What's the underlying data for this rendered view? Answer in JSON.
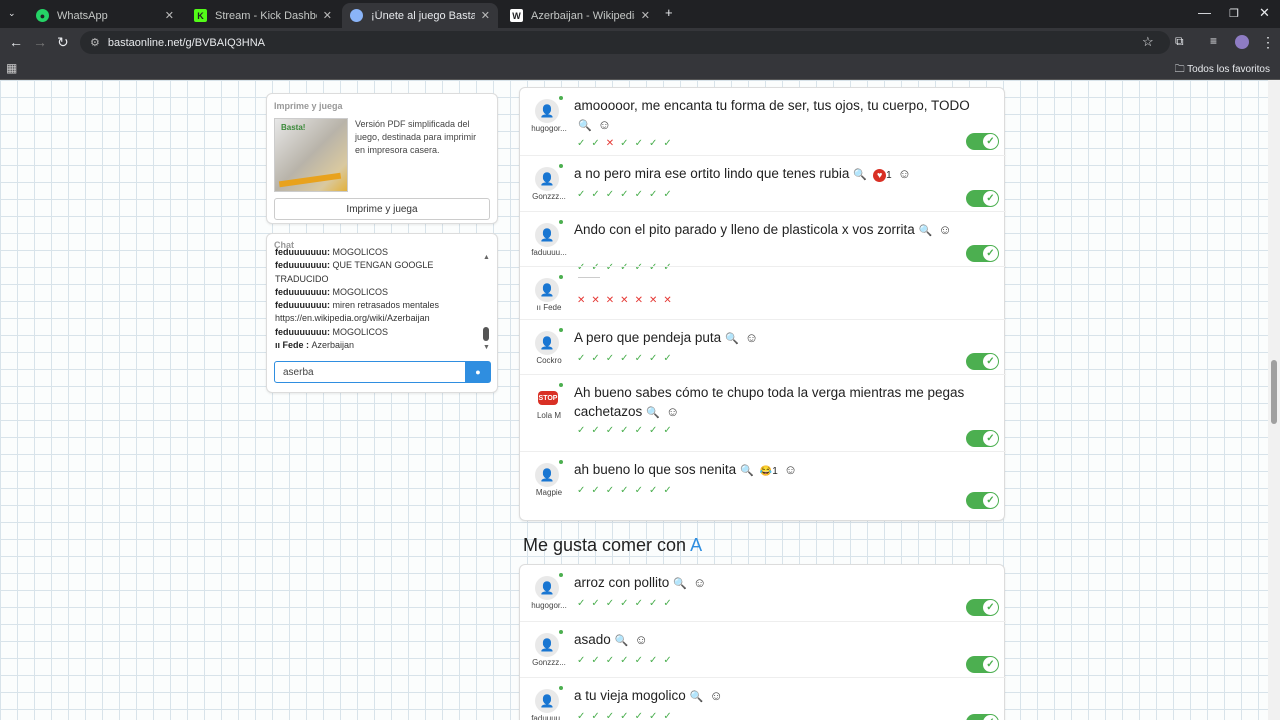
{
  "browser": {
    "tabs": [
      {
        "label": "WhatsApp",
        "icon": "whatsapp-icon",
        "color": "#25d366"
      },
      {
        "label": "Stream - Kick Dashboard",
        "icon": "kick-icon",
        "color": "#53fc18"
      },
      {
        "label": "¡Únete al juego Basta!",
        "icon": "globe-icon",
        "color": "#8ab4f8"
      },
      {
        "label": "Azerbaijan - Wikipedia",
        "icon": "wikipedia-icon",
        "color": "#ffffff"
      }
    ],
    "url": "bastaonline.net/g/BVBAIQ3HNA",
    "bookmarks_label": "Todos los favoritos"
  },
  "print_card": {
    "title": "Imprime y juega",
    "description": "Versión PDF simplificada del juego, destinada para imprimir en impresora casera.",
    "button": "Imprime y juega"
  },
  "chat": {
    "title": "Chat",
    "messages": [
      {
        "user": "feduuuuuuu:",
        "text": "MOGOLICOS"
      },
      {
        "user": "feduuuuuuu:",
        "text": "QUE TENGAN GOOGLE TRADUCIDO"
      },
      {
        "user": "feduuuuuuu:",
        "text": "MOGOLICOS"
      },
      {
        "user": "feduuuuuuu:",
        "text": "miren retrasados mentales https://en.wikipedia.org/wiki/Azerbaijan"
      },
      {
        "user": "feduuuuuuu:",
        "text": "MOGOLICOS"
      },
      {
        "user": "ıı Fede :",
        "text": "Azerbaijan"
      }
    ],
    "input_value": "aserba"
  },
  "answers_block1": [
    {
      "user": "hugogor...",
      "text": "amooooor, me encanta tu forma de ser, tus ojos, tu cuerpo, TODO",
      "votes": [
        "v",
        "v",
        "x",
        "v",
        "v",
        "v",
        "v"
      ],
      "reaction": null,
      "toggle": true
    },
    {
      "user": "Gonzzz...",
      "text": "a no pero mira ese ortito lindo que tenes rubia",
      "votes": [
        "v",
        "v",
        "v",
        "v",
        "v",
        "v",
        "v"
      ],
      "reaction": "1",
      "reaction_icon": "heart",
      "toggle": true
    },
    {
      "user": "faduuuu...",
      "text": "Ando con el pito parado y lleno de plasticola x vos zorrita",
      "votes": [
        "v",
        "v",
        "v",
        "v",
        "v",
        "v",
        "v"
      ],
      "reaction": null,
      "toggle": true
    },
    {
      "user": "ıı Fede",
      "text": "",
      "votes": [
        "x",
        "x",
        "x",
        "x",
        "x",
        "x",
        "x"
      ],
      "reaction": null,
      "toggle": false
    },
    {
      "user": "Cockro",
      "text": "A pero que pendeja puta",
      "votes": [
        "v",
        "v",
        "v",
        "v",
        "v",
        "v",
        "v"
      ],
      "reaction": null,
      "toggle": true
    },
    {
      "user": "Lola M",
      "text": "Ah bueno sabes cómo te chupo toda la verga mientras me pegas cachetazos",
      "votes": [
        "v",
        "v",
        "v",
        "v",
        "v",
        "v",
        "v"
      ],
      "reaction": null,
      "toggle": true,
      "stop_avatar": true
    },
    {
      "user": "Magpie",
      "text": "ah bueno lo que sos nenita",
      "votes": [
        "v",
        "v",
        "v",
        "v",
        "v",
        "v",
        "v"
      ],
      "reaction": "1",
      "reaction_icon": "laugh",
      "toggle": true
    }
  ],
  "section2": {
    "title": "Me gusta comer con",
    "letter": "A"
  },
  "answers_block2": [
    {
      "user": "hugogor...",
      "text": "arroz con pollito",
      "votes": [
        "v",
        "v",
        "v",
        "v",
        "v",
        "v",
        "v"
      ],
      "toggle": true
    },
    {
      "user": "Gonzzz...",
      "text": "asado",
      "votes": [
        "v",
        "v",
        "v",
        "v",
        "v",
        "v",
        "v"
      ],
      "toggle": true
    },
    {
      "user": "faduuuu...",
      "text": "a tu vieja mogolico",
      "votes": [
        "v",
        "v",
        "v",
        "v",
        "v",
        "v",
        "v"
      ],
      "toggle": true
    }
  ],
  "colors": {
    "accent": "#2f8ee0",
    "ok": "#4caf50",
    "bad": "#e53935"
  }
}
